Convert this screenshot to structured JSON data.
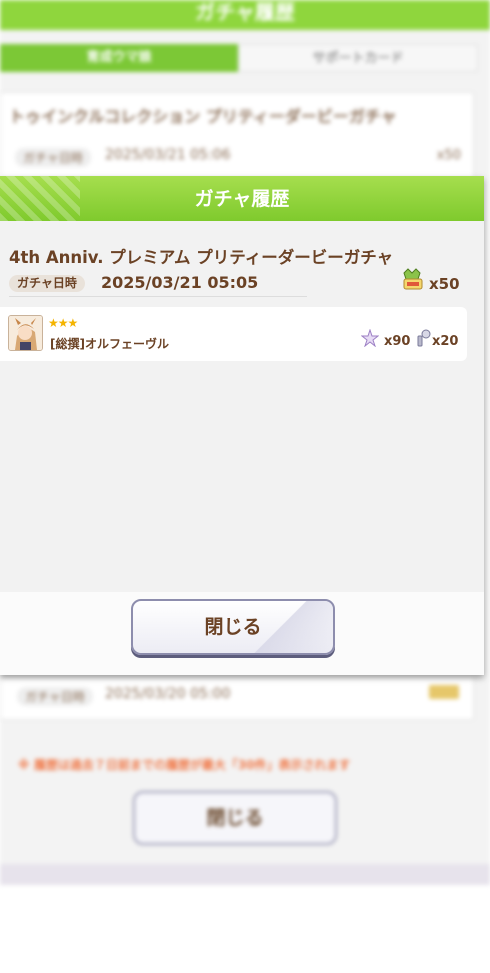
{
  "background": {
    "header_title": "ガチャ履歴",
    "tabs": [
      {
        "label": "育成ウマ娘",
        "active": true
      },
      {
        "label": "サポートカード",
        "active": false
      }
    ],
    "card1": {
      "title": "トゥインクルコレクション プリティーダービーガチャ",
      "date_label": "ガチャ日時",
      "date": "2025/03/21 05:06",
      "count": "x50"
    },
    "card2": {
      "date_label": "ガチャ日時",
      "date": "2025/03/20 05:00"
    },
    "notice": "※ 履歴は過去７日前までの履歴が最大「30件」表示されます",
    "close_label": "閉じる"
  },
  "modal": {
    "title": "ガチャ履歴",
    "entry": {
      "title": "4th Anniv. プレミアム プリティーダービーガチャ",
      "date_label": "ガチャ日時",
      "date": "2025/03/21 05:05",
      "ticket_icon": "ticket-icon",
      "ticket_count": "x50"
    },
    "result": {
      "rarity": "★★★",
      "name": "[総撰]オルフェーヴル",
      "fragment_count": "x90",
      "item_count": "x20"
    },
    "close_label": "閉じる"
  },
  "colors": {
    "header_green": "#7fca2d",
    "text_brown": "#6b4225",
    "star_gold": "#f4b400"
  }
}
